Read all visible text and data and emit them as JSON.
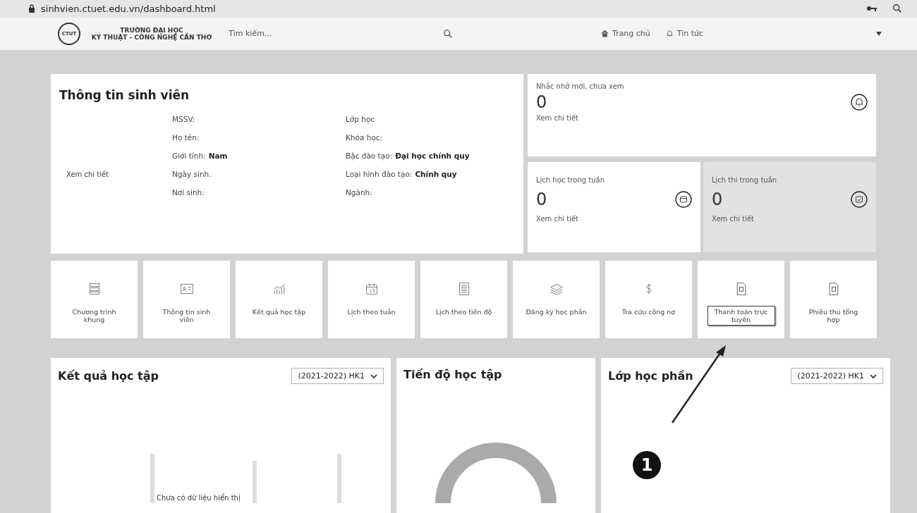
{
  "address_bar": {
    "url": "sinhvien.ctuet.edu.vn/dashboard.html"
  },
  "header": {
    "logo_text": "CTUT",
    "school_line1": "TRƯỜNG ĐẠI HỌC",
    "school_line2": "KỸ THUẬT - CÔNG NGHỆ CẦN THƠ",
    "search": {
      "placeholder": "Tìm kiếm..."
    },
    "nav": [
      {
        "label": "Trang chủ",
        "kind": "home"
      },
      {
        "label": "Tin tức",
        "kind": "bell"
      }
    ]
  },
  "student_info": {
    "title": "Thông tin sinh viên",
    "detail_link": "Xem chi tiết",
    "fields": [
      {
        "label": "MSSV:"
      },
      {
        "label": "Lớp học"
      },
      {
        "label": "Họ tên:"
      },
      {
        "label": "Khóa học:"
      },
      {
        "label": "Giới tính:",
        "value": "Nam"
      },
      {
        "label": "Bậc đào tạo:",
        "value": "Đại học chính quy"
      },
      {
        "label": "Ngày sinh."
      },
      {
        "label": "Loại hình đào tạo:",
        "value": "Chính quy"
      },
      {
        "label": "Nơi sinh:"
      },
      {
        "label": "Ngành:"
      }
    ]
  },
  "reminder": {
    "title": "Nhắc nhở mới, chưa xem",
    "count": "0",
    "link": "Xem chi tiết"
  },
  "stats": [
    {
      "title": "Lịch học trong tuần",
      "count": "0",
      "link": "Xem chi tiết",
      "kind": "calendar"
    },
    {
      "title": "Lịch thi trong tuần",
      "count": "0",
      "link": "Xem chi tiết",
      "kind": "exam"
    }
  ],
  "shortcuts": [
    {
      "label": "Chương trình khung",
      "kind": "layers",
      "highlighted": false
    },
    {
      "label": "Thông tin sinh viên",
      "kind": "idcard",
      "highlighted": false
    },
    {
      "label": "Kết quả học tập",
      "kind": "chart",
      "highlighted": false
    },
    {
      "label": "Lịch theo tuần",
      "kind": "calendar",
      "highlighted": false
    },
    {
      "label": "Lịch theo tiến độ",
      "kind": "list",
      "highlighted": false
    },
    {
      "label": "Đăng ký học phần",
      "kind": "stack",
      "highlighted": false
    },
    {
      "label": "Tra cứu công nợ",
      "kind": "dollar",
      "highlighted": false
    },
    {
      "label": "Thanh toán trực tuyến",
      "kind": "invoice",
      "highlighted": true
    },
    {
      "label": "Phiếu thu tổng hợp",
      "kind": "receipt",
      "highlighted": false
    }
  ],
  "panels": [
    {
      "title": "Kết quả học tập",
      "select": "(2021-2022) HK1",
      "kind": "bars",
      "empty_text": "Chưa có dữ liệu hiển thị"
    },
    {
      "title": "Tiến độ học tập",
      "kind": "donut"
    },
    {
      "title": "Lớp học phần",
      "select": "(2021-2022) HK1",
      "kind": "none"
    }
  ],
  "annotation": {
    "number": "1"
  }
}
